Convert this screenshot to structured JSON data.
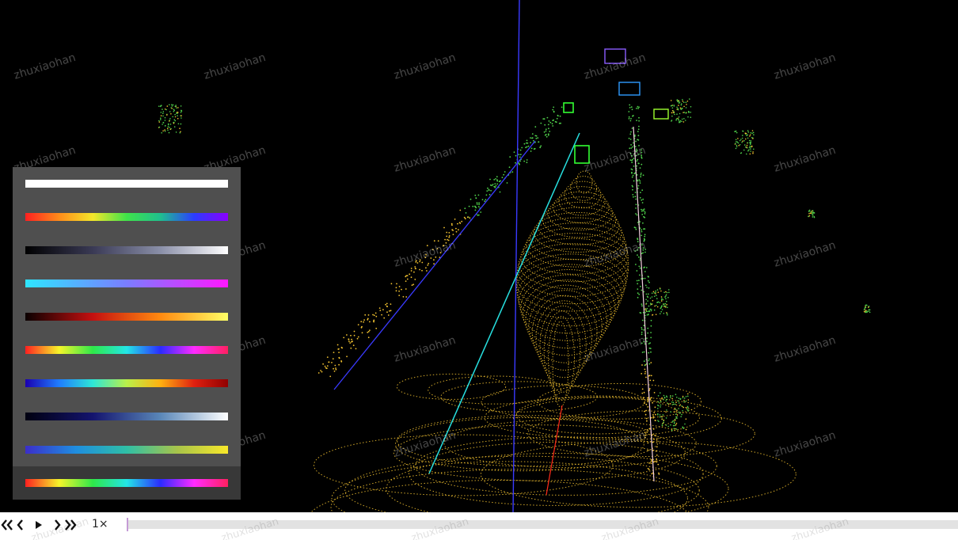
{
  "watermark_text": "zhuxiaohan",
  "colormaps": [
    {
      "name": "white",
      "stops": [
        "#ffffff",
        "#ffffff"
      ]
    },
    {
      "name": "rainbow",
      "stops": [
        "#ff2020",
        "#ff8c1a",
        "#f3e72a",
        "#3fe34a",
        "#1fbf8f",
        "#2b3cff",
        "#8a00ff"
      ]
    },
    {
      "name": "bone",
      "stops": [
        "#000000",
        "#3a3a55",
        "#8a8fa8",
        "#ffffff"
      ]
    },
    {
      "name": "cool",
      "stops": [
        "#2ee6ff",
        "#7a7dff",
        "#ff17ff"
      ]
    },
    {
      "name": "hot",
      "stops": [
        "#0a0000",
        "#c41010",
        "#ff8a10",
        "#ffff66"
      ]
    },
    {
      "name": "hsv",
      "stops": [
        "#ff2020",
        "#f6f52a",
        "#2ee84a",
        "#23e6e6",
        "#2b2bff",
        "#ff2bff",
        "#ff2060"
      ]
    },
    {
      "name": "jet",
      "stops": [
        "#1a00b0",
        "#1f7dff",
        "#2ee6d6",
        "#b9f04a",
        "#ffb010",
        "#e02010",
        "#900000"
      ]
    },
    {
      "name": "ocean-blue",
      "stops": [
        "#000010",
        "#14146e",
        "#5a87b8",
        "#ffffff"
      ]
    },
    {
      "name": "parula",
      "stops": [
        "#3b2ec9",
        "#1f8ee0",
        "#2fbfa6",
        "#a8c44a",
        "#f8e82a"
      ]
    },
    {
      "name": "hsv-alt",
      "stops": [
        "#ff2020",
        "#f6f52a",
        "#2ee84a",
        "#23e6e6",
        "#2b2bff",
        "#ff2bff",
        "#ff2060"
      ]
    }
  ],
  "selected_colormap_index": 9,
  "playback": {
    "first_label": "«",
    "prev_label": "‹",
    "play_label": "▶",
    "next_label": "›",
    "last_label": "»",
    "speed": "1×",
    "progress": 0.0
  },
  "colors": {
    "background": "#000000",
    "point_yellow": "#f2c230",
    "point_green": "#4fd04a",
    "box_green": "#33ff33",
    "line_blue": "#3a3aff",
    "line_cyan": "#27e0e0",
    "line_red": "#ff2a1a",
    "panel_bg": "#4f4f4f",
    "panel_selected": "#383838"
  }
}
